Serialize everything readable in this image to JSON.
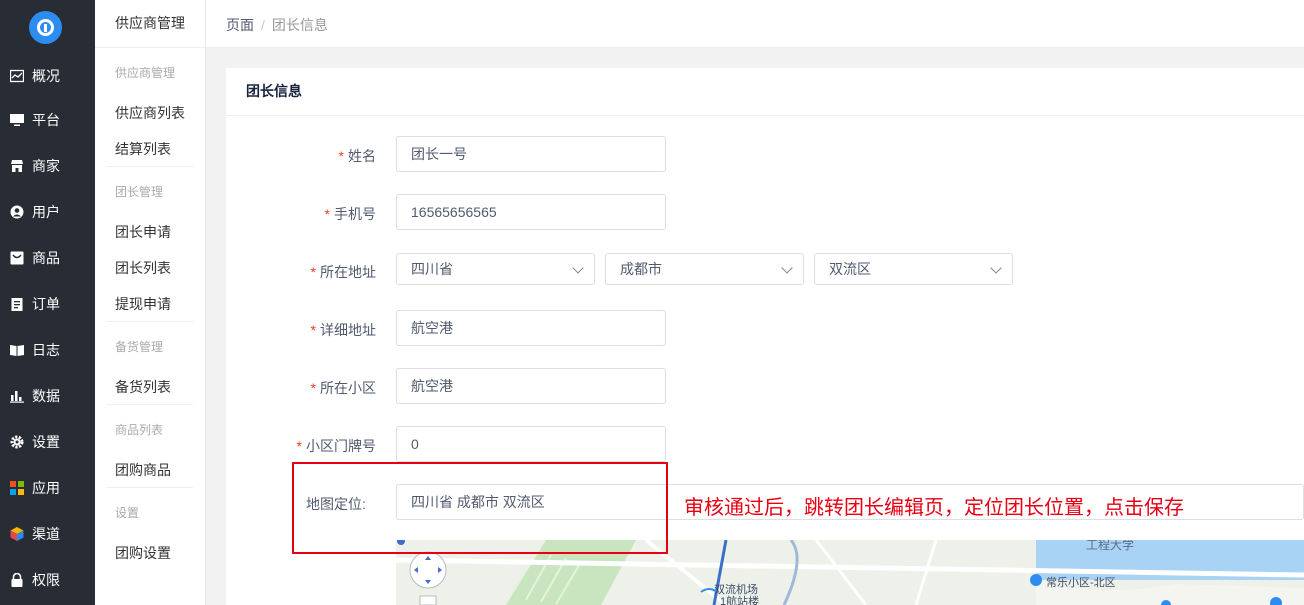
{
  "colors": {
    "nav_bg": "#282c34",
    "accent": "#2d8cf0",
    "required": "#ed4014",
    "annotation": "#e60012"
  },
  "nav": {
    "logo": "logo-icon",
    "items": [
      {
        "label": "概况",
        "icon": "chart-icon"
      },
      {
        "label": "平台",
        "icon": "monitor-icon"
      },
      {
        "label": "商家",
        "icon": "store-icon"
      },
      {
        "label": "用户",
        "icon": "user-icon"
      },
      {
        "label": "商品",
        "icon": "product-icon"
      },
      {
        "label": "订单",
        "icon": "order-icon"
      },
      {
        "label": "日志",
        "icon": "log-icon"
      },
      {
        "label": "数据",
        "icon": "bar-chart-icon"
      },
      {
        "label": "设置",
        "icon": "gear-icon"
      },
      {
        "label": "应用",
        "icon": "apps-icon"
      },
      {
        "label": "渠道",
        "icon": "cube-icon"
      },
      {
        "label": "权限",
        "icon": "lock-icon"
      }
    ]
  },
  "submenu": {
    "title": "供应商管理",
    "groups": [
      {
        "title": "供应商管理",
        "items": [
          "供应商列表",
          "结算列表"
        ]
      },
      {
        "title": "团长管理",
        "items": [
          "团长申请",
          "团长列表",
          "提现申请"
        ]
      },
      {
        "title": "备货管理",
        "items": [
          "备货列表"
        ]
      },
      {
        "title": "商品列表",
        "items": [
          "团购商品"
        ]
      },
      {
        "title": "设置",
        "items": [
          "团购设置"
        ]
      }
    ]
  },
  "breadcrumb": {
    "home": "页面",
    "sep": "/",
    "current": "团长信息"
  },
  "card": {
    "title": "团长信息"
  },
  "form": {
    "name": {
      "label": "姓名",
      "value": "团长一号"
    },
    "phone": {
      "label": "手机号",
      "value": "16565656565"
    },
    "address": {
      "label": "所在地址",
      "province": "四川省",
      "city": "成都市",
      "district": "双流区"
    },
    "detail": {
      "label": "详细地址",
      "value": "航空港"
    },
    "community": {
      "label": "所在小区",
      "value": "航空港"
    },
    "door": {
      "label": "小区门牌号",
      "value": "0"
    },
    "map": {
      "label": "地图定位:",
      "value": "四川省 成都市 双流区"
    }
  },
  "map": {
    "labels": [
      "工程大学",
      "常乐小区-北区",
      "双流机场",
      "1航站楼"
    ]
  },
  "annotation": "审核通过后，跳转团长编辑页，定位团长位置，点击保存"
}
